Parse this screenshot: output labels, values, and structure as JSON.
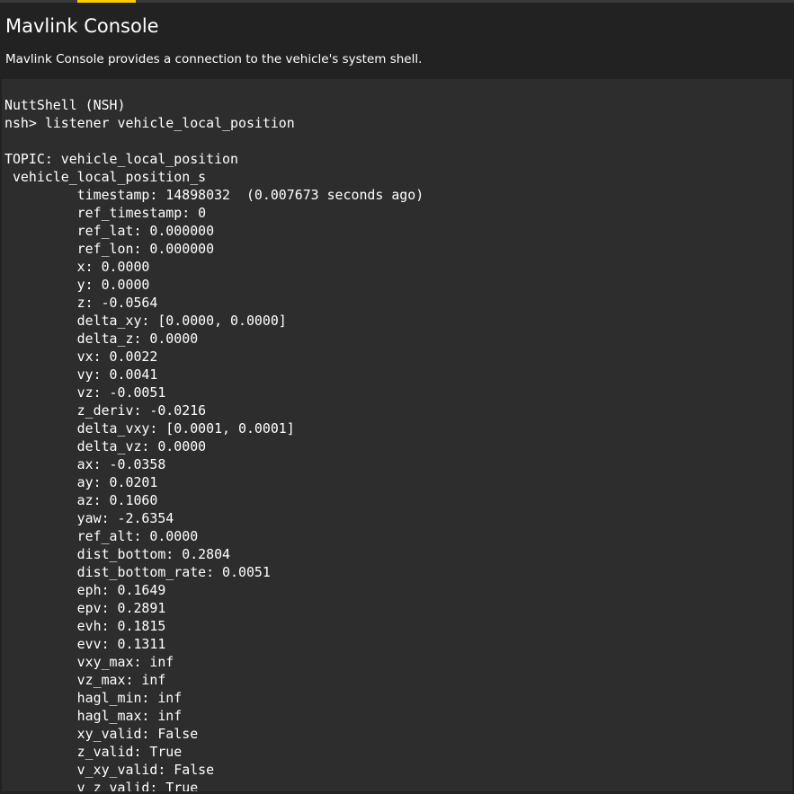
{
  "header": {
    "title": "Mavlink Console",
    "description": "Mavlink Console provides a connection to the vehicle's system shell."
  },
  "console": {
    "lines": [
      "NuttShell (NSH)",
      "nsh> listener vehicle_local_position",
      "",
      "TOPIC: vehicle_local_position",
      " vehicle_local_position_s",
      "         timestamp: 14898032  (0.007673 seconds ago)",
      "         ref_timestamp: 0",
      "         ref_lat: 0.000000",
      "         ref_lon: 0.000000",
      "         x: 0.0000",
      "         y: 0.0000",
      "         z: -0.0564",
      "         delta_xy: [0.0000, 0.0000]",
      "         delta_z: 0.0000",
      "         vx: 0.0022",
      "         vy: 0.0041",
      "         vz: -0.0051",
      "         z_deriv: -0.0216",
      "         delta_vxy: [0.0001, 0.0001]",
      "         delta_vz: 0.0000",
      "         ax: -0.0358",
      "         ay: 0.0201",
      "         az: 0.1060",
      "         yaw: -2.6354",
      "         ref_alt: 0.0000",
      "         dist_bottom: 0.2804",
      "         dist_bottom_rate: 0.0051",
      "         eph: 0.1649",
      "         epv: 0.2891",
      "         evh: 0.1815",
      "         evv: 0.1311",
      "         vxy_max: inf",
      "         vz_max: inf",
      "         hagl_min: inf",
      "         hagl_max: inf",
      "         xy_valid: False",
      "         z_valid: True",
      "         v_xy_valid: False",
      "         v_z_valid: True"
    ]
  },
  "colors": {
    "background": "#222222",
    "console_background": "#2d2d2d",
    "text": "#ffffff",
    "accent": "#ffcc00"
  }
}
